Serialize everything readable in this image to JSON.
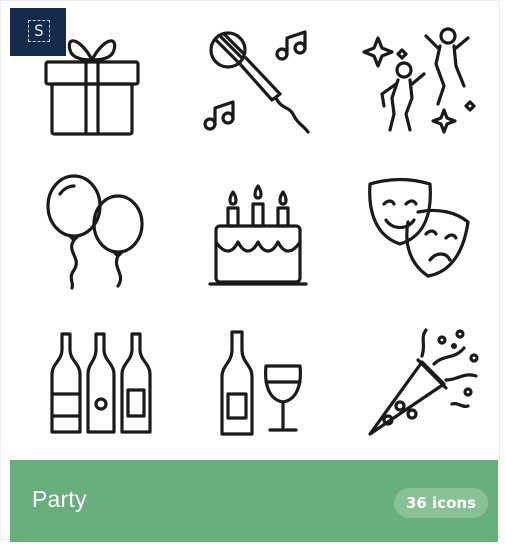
{
  "badge": {
    "letter": "S"
  },
  "icons": [
    {
      "name": "gift-icon"
    },
    {
      "name": "karaoke-microphone-icon"
    },
    {
      "name": "dancing-people-icon"
    },
    {
      "name": "balloons-icon"
    },
    {
      "name": "birthday-cake-icon"
    },
    {
      "name": "theater-masks-icon"
    },
    {
      "name": "wine-bottles-icon"
    },
    {
      "name": "champagne-glass-icon"
    },
    {
      "name": "party-popper-icon"
    }
  ],
  "footer": {
    "title": "Party",
    "count_label": "36 icons"
  },
  "colors": {
    "footer_bg": "#69ae7d",
    "pill_bg": "#88c196",
    "badge_bg": "#172a4a",
    "icon_stroke": "#1a1a1a"
  }
}
